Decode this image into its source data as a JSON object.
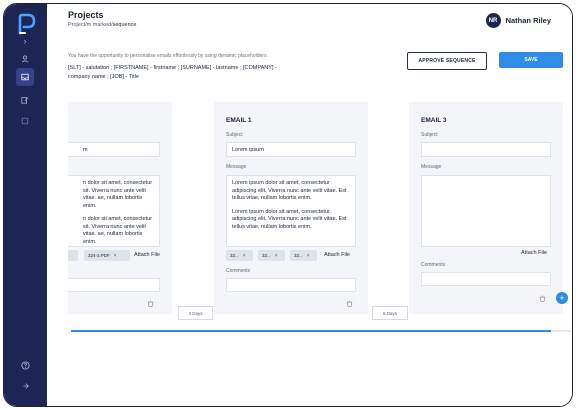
{
  "header": {
    "title": "Projects",
    "breadcrumb_prefix": "Project/m marked/",
    "breadcrumb_current": "sequence"
  },
  "user": {
    "initials": "NR",
    "name": "Nathan Riley"
  },
  "intro": {
    "hint": "You have the opportunity to personalise emails effortlessly by using dynamic placeholders.",
    "placeholders": "[SLT] - salutation ; [FIRSTNAME] - firstname ; [SURNAME] - lastname ; [COMPANY] - company name ; [JOB] - Title"
  },
  "actions": {
    "approve_label": "APPROVE SEQUENCE",
    "save_label": "SAVE"
  },
  "cards": [
    {
      "subject": "m",
      "message_p1": "n dolor sit amet, consectetur sit. Viverra nunc ante velit vitae. ae, nullam lobortis enim.",
      "message_p2": "n dolor sit amet, consectetur sit. Viverra nunc ante velit vitae. ae, nullam lobortis enim.",
      "attachments": [
        "",
        "324-3.PDF"
      ],
      "attach_label": "Attach File"
    },
    {
      "title": "EMAIL 1",
      "subject_label": "Subject",
      "subject": "Lorem ipsum",
      "message_label": "Message",
      "message_p1": "Lorem ipsum dolor sit amet, consectetur adipiscing elit. Viverra nunc ante velit vitae. Est tellus vitae, nullam lobortis enim.",
      "message_p2": "Lorem ipsum dolor sit amet, consectetur adipiscing elit. Viverra nunc ante velit vitae. Est tellus vitae, nullam lobortis enim.",
      "attachments": [
        "32...",
        "32...",
        "32..."
      ],
      "attach_label": "Attach File",
      "comments_label": "Comments"
    },
    {
      "title": "EMAIL 3",
      "subject_label": "Subject",
      "message_label": "Message",
      "attach_label": "Attach File",
      "comments_label": "Comments"
    }
  ],
  "delays": [
    "3 Days",
    "6 Days"
  ],
  "scroll_position": 0.96,
  "icons": {
    "logo": "p-logo-icon",
    "sidebar": [
      "chevron-right-icon",
      "user-icon",
      "inbox-icon",
      "edit-icon",
      "settings-icon",
      "help-icon",
      "logout-icon"
    ]
  },
  "colors": {
    "sidebar": "#1d2555",
    "accent": "#2f8ce6",
    "card": "#f4f5f9"
  }
}
